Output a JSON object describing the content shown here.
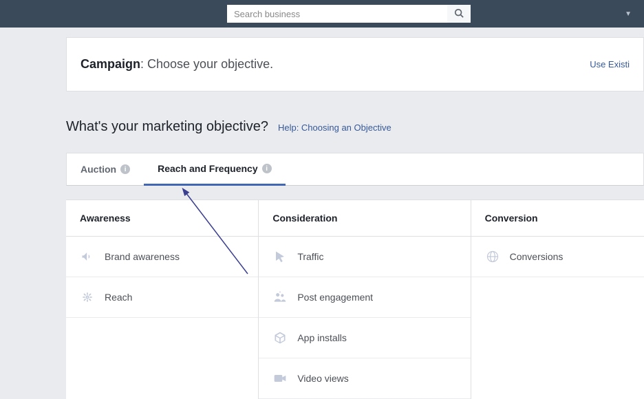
{
  "top": {
    "search_placeholder": "Search business"
  },
  "campaign_card": {
    "label": "Campaign",
    "subtitle": ": Choose your objective.",
    "use_existing": "Use Existi"
  },
  "section": {
    "heading": "What's your marketing objective?",
    "help_link": "Help: Choosing an Objective"
  },
  "tabs": {
    "auction": "Auction",
    "reach_frequency": "Reach and Frequency"
  },
  "columns": {
    "awareness": {
      "header": "Awareness",
      "item_brand": "Brand awareness",
      "item_reach": "Reach"
    },
    "consideration": {
      "header": "Consideration",
      "item_traffic": "Traffic",
      "item_post": "Post engagement",
      "item_app": "App installs",
      "item_video": "Video views"
    },
    "conversion": {
      "header": "Conversion",
      "item_conv": "Conversions"
    }
  }
}
